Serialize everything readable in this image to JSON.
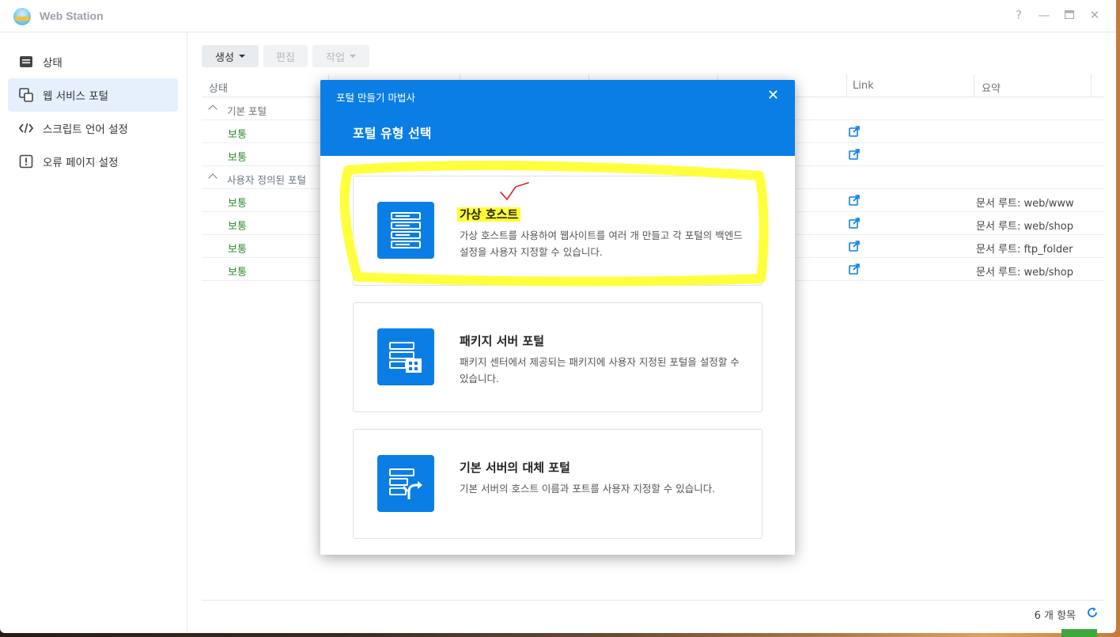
{
  "app": {
    "title": "Web Station"
  },
  "window_controls": {
    "help": "?",
    "minimize": "—",
    "maximize": "▭",
    "close": "✕"
  },
  "sidebar": {
    "items": [
      {
        "label": "상태",
        "icon": "status-icon"
      },
      {
        "label": "웹 서비스 포털",
        "icon": "portal-icon",
        "active": true
      },
      {
        "label": "스크립트 언어 설정",
        "icon": "code-icon"
      },
      {
        "label": "오류 페이지 설정",
        "icon": "error-icon"
      }
    ]
  },
  "toolbar": {
    "create_label": "생성",
    "edit_label": "편집",
    "action_label": "작업"
  },
  "grid": {
    "columns": [
      "상태",
      "Link",
      "요약"
    ],
    "groups": [
      {
        "label": "기본 포털",
        "rows": [
          {
            "status": "보통",
            "summary": ""
          },
          {
            "status": "보통",
            "summary": ""
          }
        ]
      },
      {
        "label": "사용자 정의된 포털",
        "rows": [
          {
            "status": "보통",
            "summary": "문서 루트: web/www"
          },
          {
            "status": "보통",
            "summary": "문서 루트: web/shop"
          },
          {
            "status": "보통",
            "summary": "문서 루트: ftp_folder"
          },
          {
            "status": "보통",
            "summary": "문서 루트: web/shop"
          }
        ]
      }
    ],
    "footer_count": "6 개 항목"
  },
  "dialog": {
    "title": "포털 만들기 마법사",
    "subtitle": "포털 유형 선택",
    "options": [
      {
        "title": "가상 호스트",
        "desc": "가상 호스트를 사용하여 웹사이트를 여러 개 만들고 각 포털의 백엔드 설정을 사용자 지정할 수 있습니다.",
        "icon": "virtual-host-icon"
      },
      {
        "title": "패키지 서버 포털",
        "desc": "패키지 센터에서 제공되는 패키지에 사용자 지정된 포털을 설정할 수 있습니다.",
        "icon": "package-server-icon"
      },
      {
        "title": "기본 서버의 대체 포털",
        "desc": "기본 서버의 호스트 이름과 포트를 사용자 지정할 수 있습니다.",
        "icon": "alias-portal-icon"
      }
    ]
  },
  "colors": {
    "accent": "#0b7ee6",
    "status_green": "#2e8a2e",
    "highlight": "#ffff33",
    "annotation_red": "#e02020"
  }
}
